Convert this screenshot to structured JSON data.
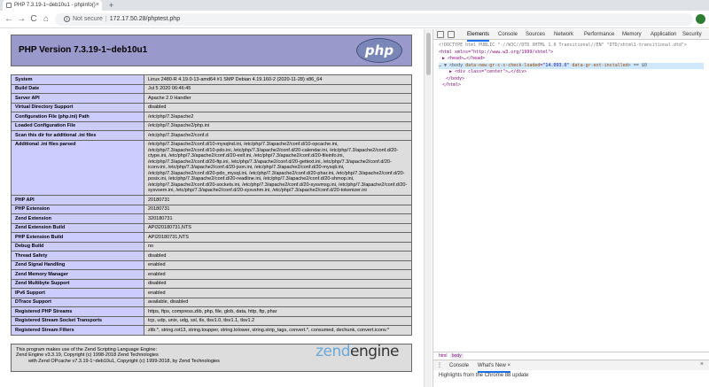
{
  "browser": {
    "tab_title": "PHP 7.3.19-1~deb10u1 - phpinfo()",
    "tab_close": "×",
    "new_tab": "+",
    "back": "←",
    "forward": "→",
    "reload": "C",
    "home": "⌂",
    "security_label": "Not secure",
    "url": "172.17.50.28/phptest.php"
  },
  "phpinfo": {
    "title": "PHP Version 7.3.19-1~deb10u1",
    "logo_text": "php",
    "rows": [
      {
        "k": "System",
        "v": "Linux 2480-R 4.19.0-13-amd64 #1 SMP Debian 4.19.160-2 (2020-11-28) x86_64"
      },
      {
        "k": "Build Date",
        "v": "Jul 5 2020 06:46:45"
      },
      {
        "k": "Server API",
        "v": "Apache 2.0 Handler"
      },
      {
        "k": "Virtual Directory Support",
        "v": "disabled"
      },
      {
        "k": "Configuration File (php.ini) Path",
        "v": "/etc/php/7.3/apache2"
      },
      {
        "k": "Loaded Configuration File",
        "v": "/etc/php/7.3/apache2/php.ini"
      },
      {
        "k": "Scan this dir for additional .ini files",
        "v": "/etc/php/7.3/apache2/conf.d"
      },
      {
        "k": "Additional .ini files parsed",
        "v": "/etc/php/7.3/apache2/conf.d/10-mysqlnd.ini, /etc/php/7.3/apache2/conf.d/10-opcache.ini, /etc/php/7.3/apache2/conf.d/10-pdo.ini, /etc/php/7.3/apache2/conf.d/20-calendar.ini, /etc/php/7.3/apache2/conf.d/20-ctype.ini, /etc/php/7.3/apache2/conf.d/20-exif.ini, /etc/php/7.3/apache2/conf.d/20-fileinfo.ini, /etc/php/7.3/apache2/conf.d/20-ftp.ini, /etc/php/7.3/apache2/conf.d/20-gettext.ini, /etc/php/7.3/apache2/conf.d/20-iconv.ini, /etc/php/7.3/apache2/conf.d/20-json.ini, /etc/php/7.3/apache2/conf.d/20-mysqli.ini, /etc/php/7.3/apache2/conf.d/20-pdo_mysql.ini, /etc/php/7.3/apache2/conf.d/20-phar.ini, /etc/php/7.3/apache2/conf.d/20-posix.ini, /etc/php/7.3/apache2/conf.d/20-readline.ini, /etc/php/7.3/apache2/conf.d/20-shmop.ini, /etc/php/7.3/apache2/conf.d/20-sockets.ini, /etc/php/7.3/apache2/conf.d/20-sysvmsg.ini, /etc/php/7.3/apache2/conf.d/20-sysvsem.ini, /etc/php/7.3/apache2/conf.d/20-sysvshm.ini, /etc/php/7.3/apache2/conf.d/20-tokenizer.ini"
      },
      {
        "k": "PHP API",
        "v": "20180731"
      },
      {
        "k": "PHP Extension",
        "v": "20180731"
      },
      {
        "k": "Zend Extension",
        "v": "320180731"
      },
      {
        "k": "Zend Extension Build",
        "v": "API320180731,NTS"
      },
      {
        "k": "PHP Extension Build",
        "v": "API20180731,NTS"
      },
      {
        "k": "Debug Build",
        "v": "no"
      },
      {
        "k": "Thread Safety",
        "v": "disabled"
      },
      {
        "k": "Zend Signal Handling",
        "v": "enabled"
      },
      {
        "k": "Zend Memory Manager",
        "v": "enabled"
      },
      {
        "k": "Zend Multibyte Support",
        "v": "disabled"
      },
      {
        "k": "IPv6 Support",
        "v": "enabled"
      },
      {
        "k": "DTrace Support",
        "v": "available, disabled"
      },
      {
        "k": "Registered PHP Streams",
        "v": "https, ftps, compress.zlib, php, file, glob, data, http, ftp, phar"
      },
      {
        "k": "Registered Stream Socket Transports",
        "v": "tcp, udp, unix, udg, ssl, tls, tlsv1.0, tlsv1.1, tlsv1.2"
      },
      {
        "k": "Registered Stream Filters",
        "v": "zlib.*, string.rot13, string.toupper, string.tolower, string.strip_tags, convert.*, consumed, dechunk, convert.iconv.*"
      }
    ],
    "zend_line1": "This program makes use of the Zend Scripting Language Engine:",
    "zend_line2": "Zend Engine v3.3.19, Copyright (c) 1998-2018 Zend Technologies",
    "zend_line3": "with Zend OPcache v7.3.19-1~deb10u1, Copyright (c) 1999-2018, by Zend Technologies",
    "zend_logo_a": "zend",
    "zend_logo_b": "engine"
  },
  "devtools": {
    "tabs": [
      "Elements",
      "Console",
      "Sources",
      "Network",
      "Performance",
      "Memory",
      "Application",
      "Security"
    ],
    "code": {
      "doctype": "<!DOCTYPE html PUBLIC \"-//W3C//DTD XHTML 1.0 Transitional//EN\" \"DTD/xhtml1-transitional.dtd\">",
      "html_open": "<html xmlns=\"http://www.w3.org/1999/xhtml\">",
      "head": "▶ <head>…</head>",
      "body_prefix": "… ▼ <body ",
      "body_attr1": "data-new-gr-c-s-check-loaded",
      "body_val1": "\"14.093.0\"",
      "body_attr2": " data-gr-ext-installed",
      "body_suffix": "> == $0",
      "div": "▶ <div class=\"center\">…</div>",
      "body_close": "</body>",
      "html_close": "</html>"
    },
    "breadcrumb": [
      "html",
      "body"
    ],
    "drawer_tabs": [
      "Console",
      "What's New"
    ],
    "drawer_tab_close": "×",
    "drawer_close": "×",
    "drawer_text": "Highlights from the Chrome 88 update"
  }
}
